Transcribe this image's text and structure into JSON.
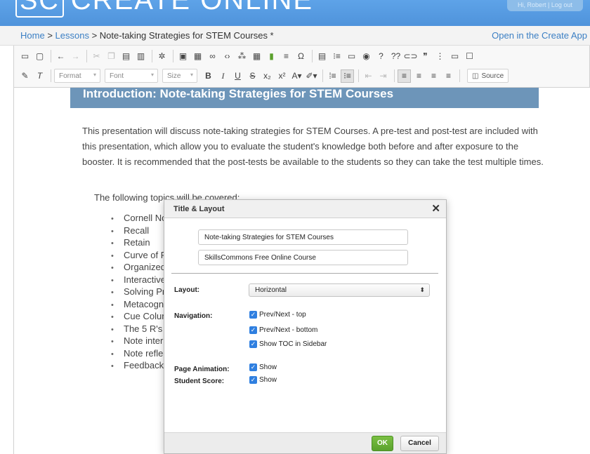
{
  "banner": {
    "logo_mark": "SC",
    "logo_text": "CREATE ONLINE",
    "user_text": "Hi, Robert | Log out"
  },
  "breadcrumb": {
    "home": "Home",
    "sep1": ">",
    "lessons": "Lessons",
    "sep2": ">",
    "current": "Note-taking Strategies for STEM Courses *",
    "open_app": "Open in the Create App"
  },
  "toolbar": {
    "row1_icons": [
      "save-icon",
      "preview-icon",
      "undo-icon",
      "redo-icon",
      "cut-icon",
      "copy-icon",
      "paste-icon",
      "paste-text-icon",
      "settings-icon",
      "image-icon",
      "media-icon",
      "link-icon",
      "code-icon",
      "widget-icon",
      "table-icon",
      "book-icon",
      "divider-icon",
      "special-char-icon",
      "template-icon",
      "list-icon",
      "comment-icon",
      "play-icon",
      "question-icon",
      "double-question-icon",
      "link-chain-icon",
      "quote-icon",
      "div-icon",
      "window-icon",
      "maximize-icon"
    ],
    "format_label": "Format",
    "font_label": "Font",
    "size_label": "Size",
    "bold": "B",
    "italic": "I",
    "underline": "U",
    "strike": "S",
    "source_label": "Source"
  },
  "content": {
    "heading": "Introduction: Note-taking Strategies for STEM Courses",
    "paragraph": "This presentation will discuss note-taking strategies for STEM Courses.  A pre-test and post-test are included with this presentation, which allow you to evaluate the student's knowledge both before and after exposure to the booster. It is recommended that the post-tests be available to the students so they can take the test multiple times.",
    "topics_intro": "The following topics will be covered:",
    "topics": [
      "Cornell Notes",
      "Recall",
      "Retain",
      "Curve of Forgetting",
      "Organized",
      "Interactive",
      "Solving Problems",
      "Metacognition",
      "Cue Column",
      "The 5 R's",
      "Note interaction",
      "Note reflection",
      "Feedback"
    ]
  },
  "dialog": {
    "title": "Title & Layout",
    "close": "✕",
    "title_value": "Note-taking Strategies for STEM Courses",
    "subtitle_value": "SkillsCommons Free Online Course",
    "layout_label": "Layout:",
    "layout_value": "Horizontal",
    "navigation_label": "Navigation:",
    "nav_top": "Prev/Next - top",
    "nav_bottom": "Prev/Next - bottom",
    "nav_toc": "Show TOC in Sidebar",
    "page_animation_label": "Page Animation:",
    "page_animation_value": "Show",
    "student_score_label": "Student Score:",
    "student_score_value": "Show",
    "ok": "OK",
    "cancel": "Cancel"
  }
}
